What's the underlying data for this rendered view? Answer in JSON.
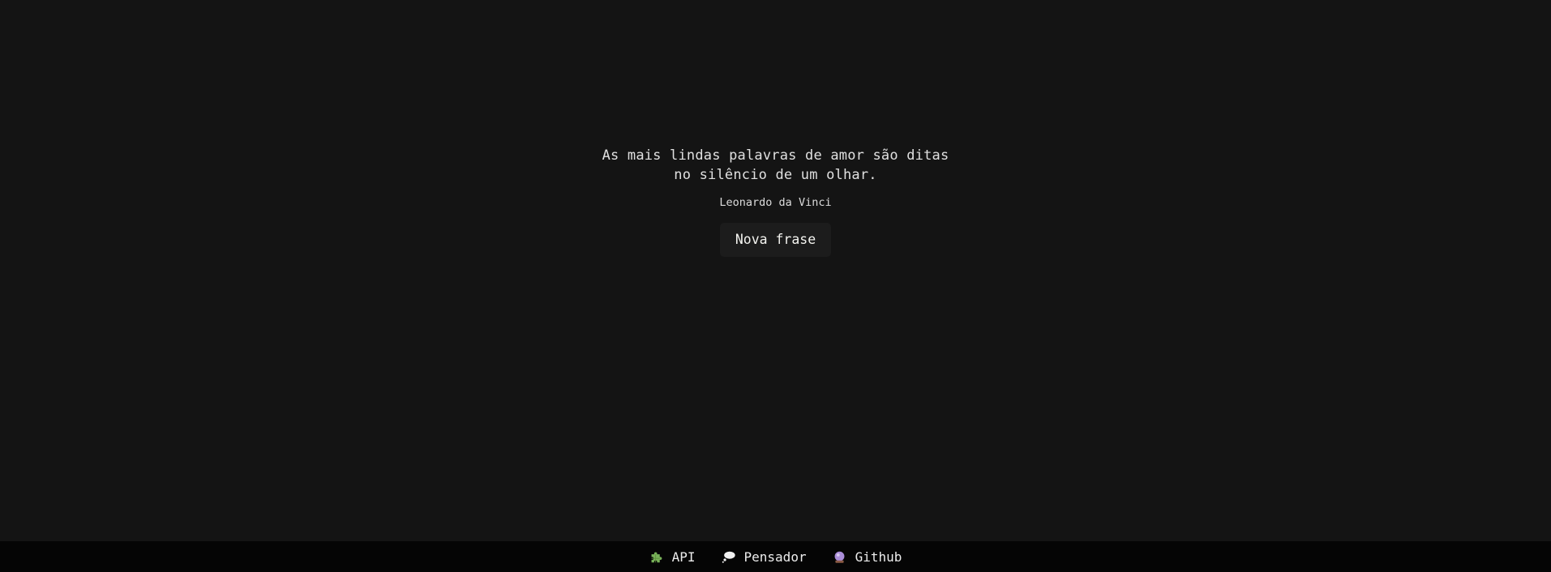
{
  "quote": {
    "text": "As mais lindas palavras de amor são ditas no silêncio de um olhar.",
    "author": "Leonardo da Vinci"
  },
  "actions": {
    "new_quote_label": "Nova frase"
  },
  "footer": {
    "links": [
      {
        "label": "API",
        "icon": "puzzle-icon"
      },
      {
        "label": "Pensador",
        "icon": "thought-bubble-icon"
      },
      {
        "label": "Github",
        "icon": "crystal-ball-icon"
      }
    ]
  },
  "colors": {
    "background": "#141414",
    "footer_background": "#050505",
    "button_background": "#1c1c1c",
    "text": "#e0e0e0"
  }
}
